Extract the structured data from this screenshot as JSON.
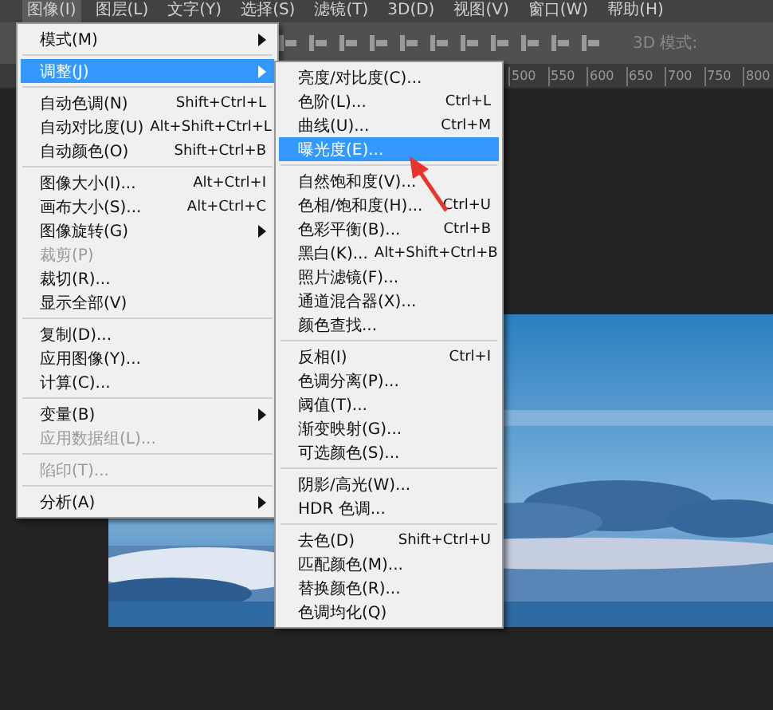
{
  "menu_bar": [
    {
      "label": "图像(I)",
      "selected": true
    },
    {
      "label": "图层(L)",
      "selected": false
    },
    {
      "label": "文字(Y)",
      "selected": false
    },
    {
      "label": "选择(S)",
      "selected": false
    },
    {
      "label": "滤镜(T)",
      "selected": false
    },
    {
      "label": "3D(D)",
      "selected": false
    },
    {
      "label": "视图(V)",
      "selected": false
    },
    {
      "label": "窗口(W)",
      "selected": false
    },
    {
      "label": "帮助(H)",
      "selected": false
    }
  ],
  "options_bar": {
    "mode_label": "3D 模式:"
  },
  "ruler": {
    "ticks": [
      "500",
      "550",
      "600",
      "650",
      "700",
      "750",
      "800"
    ]
  },
  "image_menu": [
    {
      "kind": "item",
      "label": "模式(M)",
      "submenu": true,
      "selected": false,
      "disabled": false
    },
    {
      "kind": "separator"
    },
    {
      "kind": "item",
      "label": "调整(J)",
      "submenu": true,
      "selected": true,
      "disabled": false
    },
    {
      "kind": "separator"
    },
    {
      "kind": "item",
      "label": "自动色调(N)",
      "shortcut": "Shift+Ctrl+L",
      "submenu": false,
      "selected": false,
      "disabled": false
    },
    {
      "kind": "item",
      "label": "自动对比度(U)",
      "shortcut": "Alt+Shift+Ctrl+L",
      "submenu": false,
      "selected": false,
      "disabled": false
    },
    {
      "kind": "item",
      "label": "自动颜色(O)",
      "shortcut": "Shift+Ctrl+B",
      "submenu": false,
      "selected": false,
      "disabled": false
    },
    {
      "kind": "separator"
    },
    {
      "kind": "item",
      "label": "图像大小(I)...",
      "shortcut": "Alt+Ctrl+I",
      "submenu": false,
      "selected": false,
      "disabled": false
    },
    {
      "kind": "item",
      "label": "画布大小(S)...",
      "shortcut": "Alt+Ctrl+C",
      "submenu": false,
      "selected": false,
      "disabled": false
    },
    {
      "kind": "item",
      "label": "图像旋转(G)",
      "submenu": true,
      "selected": false,
      "disabled": false
    },
    {
      "kind": "item",
      "label": "裁剪(P)",
      "submenu": false,
      "selected": false,
      "disabled": true
    },
    {
      "kind": "item",
      "label": "裁切(R)...",
      "submenu": false,
      "selected": false,
      "disabled": false
    },
    {
      "kind": "item",
      "label": "显示全部(V)",
      "submenu": false,
      "selected": false,
      "disabled": false
    },
    {
      "kind": "separator"
    },
    {
      "kind": "item",
      "label": "复制(D)...",
      "submenu": false,
      "selected": false,
      "disabled": false
    },
    {
      "kind": "item",
      "label": "应用图像(Y)...",
      "submenu": false,
      "selected": false,
      "disabled": false
    },
    {
      "kind": "item",
      "label": "计算(C)...",
      "submenu": false,
      "selected": false,
      "disabled": false
    },
    {
      "kind": "separator"
    },
    {
      "kind": "item",
      "label": "变量(B)",
      "submenu": true,
      "selected": false,
      "disabled": false
    },
    {
      "kind": "item",
      "label": "应用数据组(L)...",
      "submenu": false,
      "selected": false,
      "disabled": true
    },
    {
      "kind": "separator"
    },
    {
      "kind": "item",
      "label": "陷印(T)...",
      "submenu": false,
      "selected": false,
      "disabled": true
    },
    {
      "kind": "separator"
    },
    {
      "kind": "item",
      "label": "分析(A)",
      "submenu": true,
      "selected": false,
      "disabled": false
    }
  ],
  "adjust_menu": [
    {
      "kind": "item",
      "label": "亮度/对比度(C)...",
      "selected": false
    },
    {
      "kind": "item",
      "label": "色阶(L)...",
      "shortcut": "Ctrl+L",
      "selected": false
    },
    {
      "kind": "item",
      "label": "曲线(U)...",
      "shortcut": "Ctrl+M",
      "selected": false
    },
    {
      "kind": "item",
      "label": "曝光度(E)...",
      "selected": true
    },
    {
      "kind": "separator"
    },
    {
      "kind": "item",
      "label": "自然饱和度(V)...",
      "selected": false
    },
    {
      "kind": "item",
      "label": "色相/饱和度(H)...",
      "shortcut": "Ctrl+U",
      "selected": false
    },
    {
      "kind": "item",
      "label": "色彩平衡(B)...",
      "shortcut": "Ctrl+B",
      "selected": false
    },
    {
      "kind": "item",
      "label": "黑白(K)...",
      "shortcut": "Alt+Shift+Ctrl+B",
      "selected": false
    },
    {
      "kind": "item",
      "label": "照片滤镜(F)...",
      "selected": false
    },
    {
      "kind": "item",
      "label": "通道混合器(X)...",
      "selected": false
    },
    {
      "kind": "item",
      "label": "颜色查找...",
      "selected": false
    },
    {
      "kind": "separator"
    },
    {
      "kind": "item",
      "label": "反相(I)",
      "shortcut": "Ctrl+I",
      "selected": false
    },
    {
      "kind": "item",
      "label": "色调分离(P)...",
      "selected": false
    },
    {
      "kind": "item",
      "label": "阈值(T)...",
      "selected": false
    },
    {
      "kind": "item",
      "label": "渐变映射(G)...",
      "selected": false
    },
    {
      "kind": "item",
      "label": "可选颜色(S)...",
      "selected": false
    },
    {
      "kind": "separator"
    },
    {
      "kind": "item",
      "label": "阴影/高光(W)...",
      "selected": false
    },
    {
      "kind": "item",
      "label": "HDR 色调...",
      "selected": false
    },
    {
      "kind": "separator"
    },
    {
      "kind": "item",
      "label": "去色(D)",
      "shortcut": "Shift+Ctrl+U",
      "selected": false
    },
    {
      "kind": "item",
      "label": "匹配颜色(M)...",
      "selected": false
    },
    {
      "kind": "item",
      "label": "替换颜色(R)...",
      "selected": false
    },
    {
      "kind": "item",
      "label": "色调均化(Q)",
      "selected": false
    }
  ]
}
